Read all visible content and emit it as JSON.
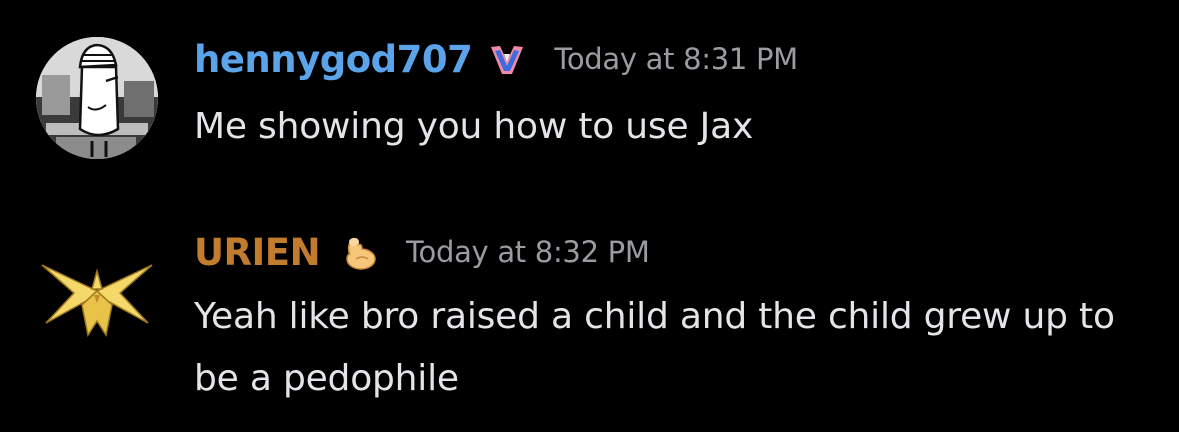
{
  "colors": {
    "background": "#000000",
    "message_text": "#e4e5e8",
    "timestamp": "#9a9ca2"
  },
  "messages": [
    {
      "username": "hennygod707",
      "username_color": "#5ba4ea",
      "badge_icon": "crest-badge-icon",
      "timestamp": "Today at 8:31 PM",
      "text": "Me showing you how to use Jax",
      "avatar_icon": "sketch-avatar"
    },
    {
      "username": "URIEN",
      "username_color": "#c27c2e",
      "badge_icon": "flexing-arm-icon",
      "timestamp": "Today at 8:32 PM",
      "text": "Yeah like bro raised a child and the child grew up to be a pedophile",
      "avatar_icon": "zapdos-avatar"
    }
  ]
}
